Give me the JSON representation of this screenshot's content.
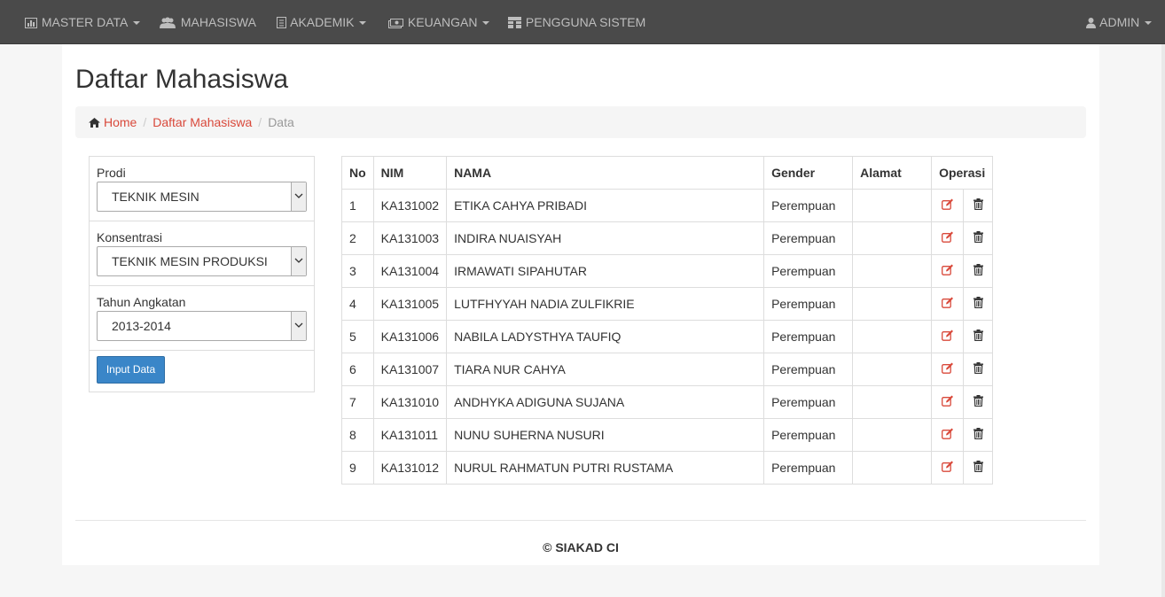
{
  "nav": {
    "master_data": "MASTER DATA",
    "mahasiswa": "MAHASISWA",
    "akademik": "AKADEMIK",
    "keuangan": "KEUANGAN",
    "pengguna": "PENGGUNA SISTEM",
    "admin": "ADMIN"
  },
  "page": {
    "title": "Daftar Mahasiswa"
  },
  "breadcrumb": {
    "home": "Home",
    "list": "Daftar Mahasiswa",
    "current": "Data"
  },
  "filters": {
    "prodi_label": "Prodi",
    "prodi_value": "TEKNIK MESIN",
    "konsentrasi_label": "Konsentrasi",
    "konsentrasi_value": "TEKNIK MESIN PRODUKSI",
    "tahun_label": "Tahun Angkatan",
    "tahun_value": "2013-2014",
    "input_button": "Input Data"
  },
  "table": {
    "headers": {
      "no": "No",
      "nim": "NIM",
      "nama": "NAMA",
      "gender": "Gender",
      "alamat": "Alamat",
      "operasi": "Operasi"
    },
    "rows": [
      {
        "no": "1",
        "nim": "KA131002",
        "nama": "ETIKA CAHYA PRIBADI",
        "gender": "Perempuan",
        "alamat": ""
      },
      {
        "no": "2",
        "nim": "KA131003",
        "nama": "INDIRA NUAISYAH",
        "gender": "Perempuan",
        "alamat": ""
      },
      {
        "no": "3",
        "nim": "KA131004",
        "nama": "IRMAWATI SIPAHUTAR",
        "gender": "Perempuan",
        "alamat": ""
      },
      {
        "no": "4",
        "nim": "KA131005",
        "nama": "LUTFHYYAH NADIA ZULFIKRIE",
        "gender": "Perempuan",
        "alamat": ""
      },
      {
        "no": "5",
        "nim": "KA131006",
        "nama": "NABILA LADYSTHYA TAUFIQ",
        "gender": "Perempuan",
        "alamat": ""
      },
      {
        "no": "6",
        "nim": "KA131007",
        "nama": "TIARA NUR CAHYA",
        "gender": "Perempuan",
        "alamat": ""
      },
      {
        "no": "7",
        "nim": "KA131010",
        "nama": "ANDHYKA ADIGUNA SUJANA",
        "gender": "Perempuan",
        "alamat": ""
      },
      {
        "no": "8",
        "nim": "KA131011",
        "nama": "NUNU SUHERNA NUSURI",
        "gender": "Perempuan",
        "alamat": ""
      },
      {
        "no": "9",
        "nim": "KA131012",
        "nama": "NURUL RAHMATUN PUTRI RUSTAMA",
        "gender": "Perempuan",
        "alamat": ""
      }
    ],
    "edit_icon": "edit-icon",
    "delete_icon": "trash-icon"
  },
  "footer": {
    "text": "© SIAKAD CI"
  },
  "colors": {
    "navbar": "#4a4a4a",
    "link": "#d9493b",
    "primary_button": "#3a86c8"
  }
}
